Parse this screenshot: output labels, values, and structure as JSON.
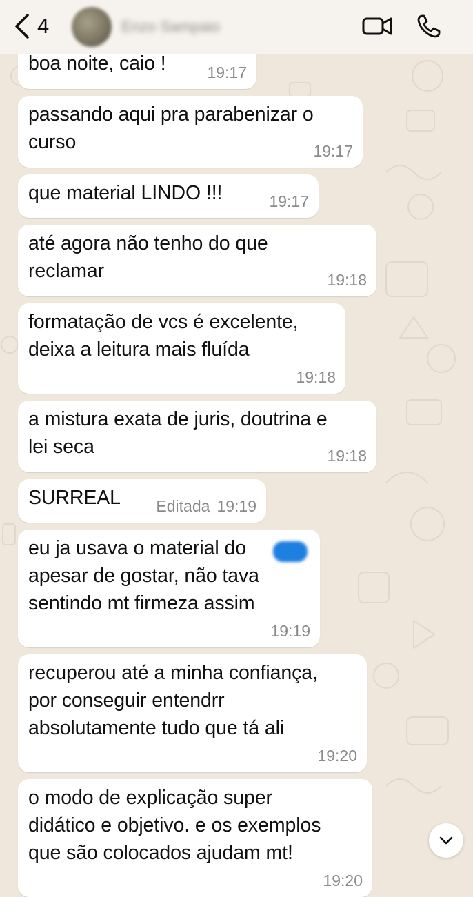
{
  "header": {
    "back_count": "4",
    "contact_name": "Enzo Sampaio"
  },
  "messages": [
    {
      "text": "boa noite, caio !",
      "time": "19:17"
    },
    {
      "text": "passando aqui pra parabenizar o\ncurso",
      "time": "19:17"
    },
    {
      "text": "que material LINDO !!!",
      "time": "19:17"
    },
    {
      "text": "até agora não tenho do que\nreclamar",
      "time": "19:18"
    },
    {
      "text": "formatação de vcs é excelente,\ndeixa a leitura mais fluída",
      "time": "19:18"
    },
    {
      "text": "a mistura exata de juris, doutrina e\nlei seca",
      "time": "19:18"
    },
    {
      "text": "SURREAL",
      "edited": "Editada",
      "time": "19:19"
    },
    {
      "text": "eu ja usava o material do\napesar de gostar, não tava\nsentindo mt firmeza assim",
      "time": "19:19"
    },
    {
      "text": "recuperou até a minha confiança,\npor conseguir entendrr\nabsolutamente tudo que tá ali",
      "time": "19:20"
    },
    {
      "text": "o modo de explicação super\ndidático e objetivo. e os exemplos\nque são colocados ajudam mt!",
      "time": "19:20"
    }
  ],
  "colors": {
    "wallpaper": "#efe7dc",
    "bubble": "#ffffff",
    "timestamp": "#8a8a8a",
    "header_bg": "#f6f3ef",
    "redaction_blue": "#1f7fe0"
  },
  "icons": {
    "back": "chevron-left-icon",
    "video": "video-camera-icon",
    "call": "phone-icon",
    "scroll_down": "chevron-down-icon"
  }
}
